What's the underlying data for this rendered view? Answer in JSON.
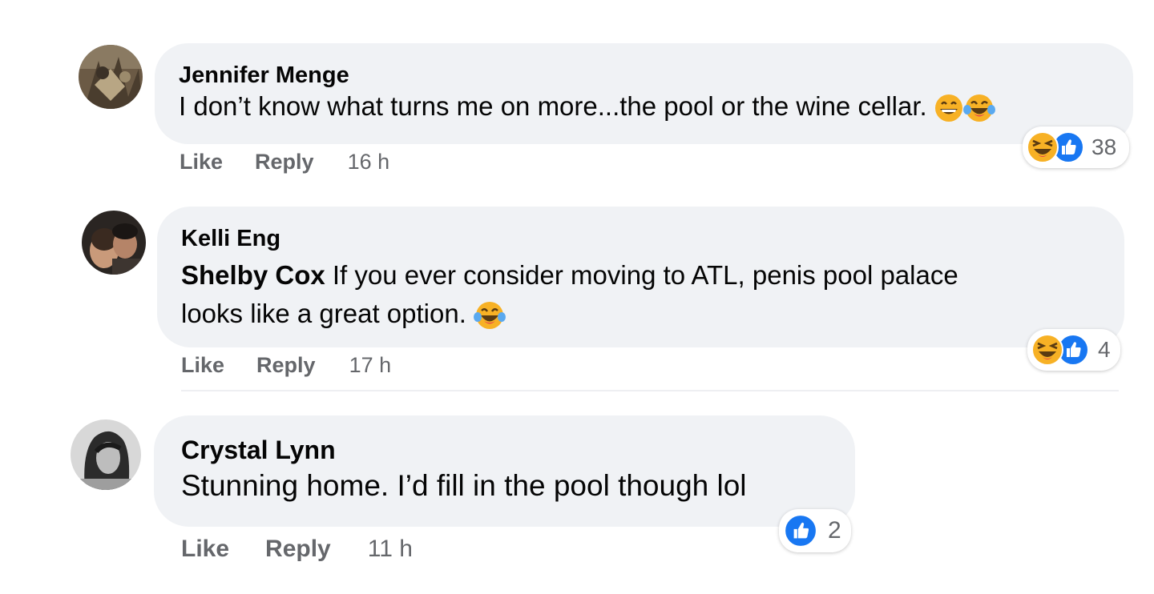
{
  "comments": [
    {
      "author": "Jennifer Menge",
      "mention": "",
      "text_line1": "I don’t know what turns me on more...the pool or the wine cellar.",
      "text_line2": "",
      "actions": {
        "like": "Like",
        "reply": "Reply",
        "time": "16 h"
      },
      "reaction_count": "38",
      "reaction_icons": [
        "laughing-emoji",
        "like-thumb"
      ],
      "text_emojis": [
        "grinning-emoji",
        "tears-of-joy-emoji"
      ]
    },
    {
      "author": "Kelli Eng",
      "mention": "Shelby Cox",
      "text_line1": "If you ever consider moving to ATL, penis pool palace",
      "text_line2": "looks like a great option.",
      "actions": {
        "like": "Like",
        "reply": "Reply",
        "time": "17 h"
      },
      "reaction_count": "4",
      "reaction_icons": [
        "laughing-emoji",
        "like-thumb"
      ],
      "text_emojis": [
        "tears-of-joy-emoji"
      ]
    },
    {
      "author": "Crystal Lynn",
      "mention": "",
      "text_line1": "Stunning home. I’d fill in the pool though lol",
      "text_line2": "",
      "actions": {
        "like": "Like",
        "reply": "Reply",
        "time": "11 h"
      },
      "reaction_count": "2",
      "reaction_icons": [
        "like-thumb"
      ],
      "text_emojis": []
    }
  ],
  "colors": {
    "bubble": "#f0f2f5",
    "like_blue": "#1877f2",
    "emoji_yellow": "#f7b125",
    "meta_gray": "#65676b"
  }
}
